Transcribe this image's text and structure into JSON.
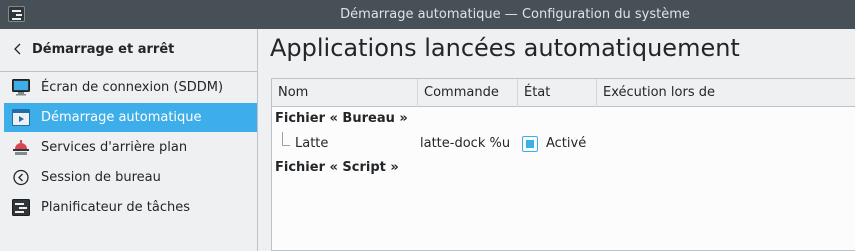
{
  "window": {
    "title": "Démarrage automatique — Configuration du système"
  },
  "sidebar": {
    "header": "Démarrage et arrêt",
    "items": [
      {
        "label": "Écran de connexion (SDDM)",
        "icon": "monitor-icon"
      },
      {
        "label": "Démarrage automatique",
        "icon": "autostart-icon",
        "selected": true
      },
      {
        "label": "Services d'arrière plan",
        "icon": "services-icon"
      },
      {
        "label": "Session de bureau",
        "icon": "session-icon"
      },
      {
        "label": "Planificateur de tâches",
        "icon": "task-scheduler-icon"
      }
    ]
  },
  "main": {
    "title": "Applications lancées automatiquement",
    "columns": [
      "Nom",
      "Commande",
      "État",
      "Exécution lors de"
    ],
    "groups": [
      {
        "label": "Fichier « Bureau »",
        "entries": [
          {
            "name": "Latte",
            "command": "latte-dock %u",
            "state": "Activé",
            "checked": true,
            "run_on": ""
          }
        ]
      },
      {
        "label": "Fichier « Script »",
        "entries": []
      }
    ]
  },
  "colors": {
    "titlebar": "#475057",
    "accent": "#3daee9",
    "background": "#eff0f1",
    "view": "#fcfcfc"
  }
}
